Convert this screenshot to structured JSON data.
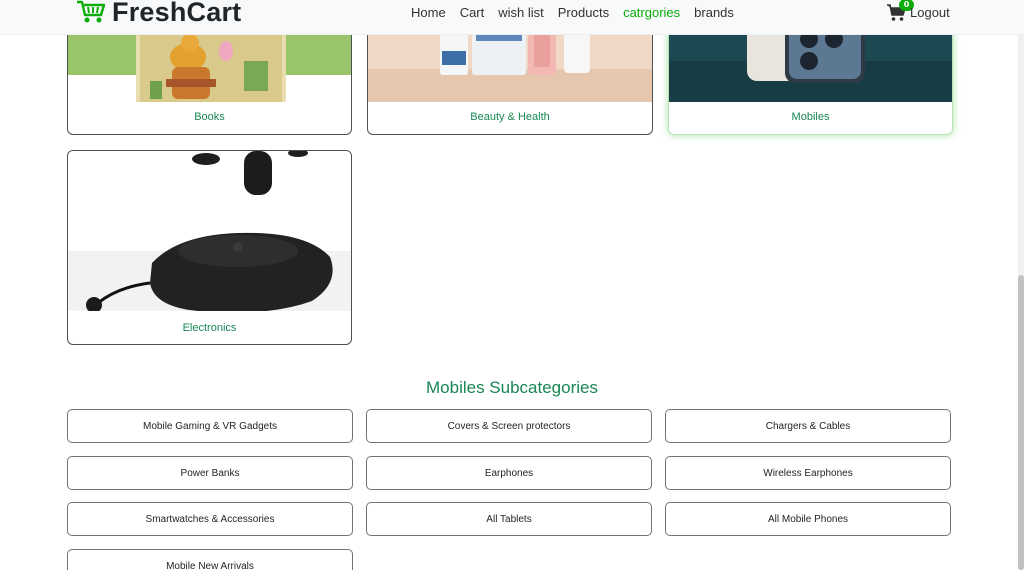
{
  "brand": {
    "name": "FreshCart"
  },
  "nav": {
    "items": [
      {
        "label": "Home",
        "active": false
      },
      {
        "label": "Cart",
        "active": false
      },
      {
        "label": "wish list",
        "active": false
      },
      {
        "label": "Products",
        "active": false
      },
      {
        "label": "catrgories",
        "active": true
      },
      {
        "label": "brands",
        "active": false
      }
    ],
    "cart_count": "0",
    "logout_label": "Logout"
  },
  "categories": [
    {
      "name": "Books"
    },
    {
      "name": "Beauty & Health"
    },
    {
      "name": "Mobiles"
    },
    {
      "name": "Electronics"
    }
  ],
  "subcategories": {
    "heading": "Mobiles Subcategories",
    "items": [
      "Mobile Gaming & VR Gadgets",
      "Covers & Screen protectors",
      "Chargers & Cables",
      "Power Banks",
      "Earphones",
      "Wireless Earphones",
      "Smartwatches & Accessories",
      "All Tablets",
      "All Mobile Phones",
      "Mobile New Arrivals"
    ]
  },
  "colors": {
    "accent": "#0aad0a",
    "title_green": "#198754"
  }
}
